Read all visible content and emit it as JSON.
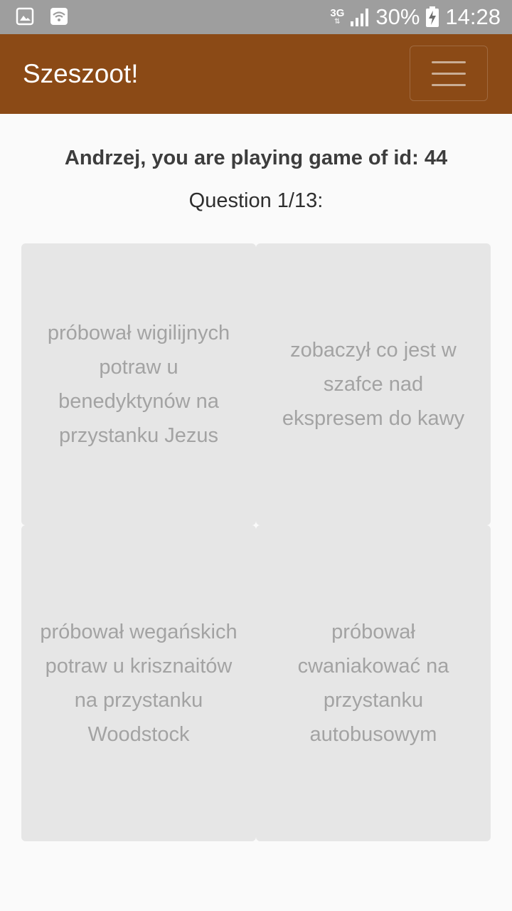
{
  "status_bar": {
    "left_icons": [
      "image-icon",
      "wifi-icon"
    ],
    "network": "3G",
    "battery": "30%",
    "time": "14:28"
  },
  "navbar": {
    "brand": "Szeszoot!",
    "menu_icon": "hamburger-menu-icon"
  },
  "game": {
    "heading": "Andrzej, you are playing game of id: 44",
    "question": "Question 1/13:"
  },
  "answers": [
    "próbował wigilijnych potraw u benedyktynów na przystanku Jezus",
    "zobaczył co jest w szafce nad ekspresem do kawy",
    "próbował wegańskich potraw u krisznaitów na przystanku Woodstock",
    "próbował cwaniakować na przystanku autobusowym"
  ],
  "colors": {
    "navbar": "#8b4a16",
    "status_bar": "#9e9e9e",
    "answer_bg": "#e6e6e6",
    "answer_text": "#a3a3a3"
  }
}
